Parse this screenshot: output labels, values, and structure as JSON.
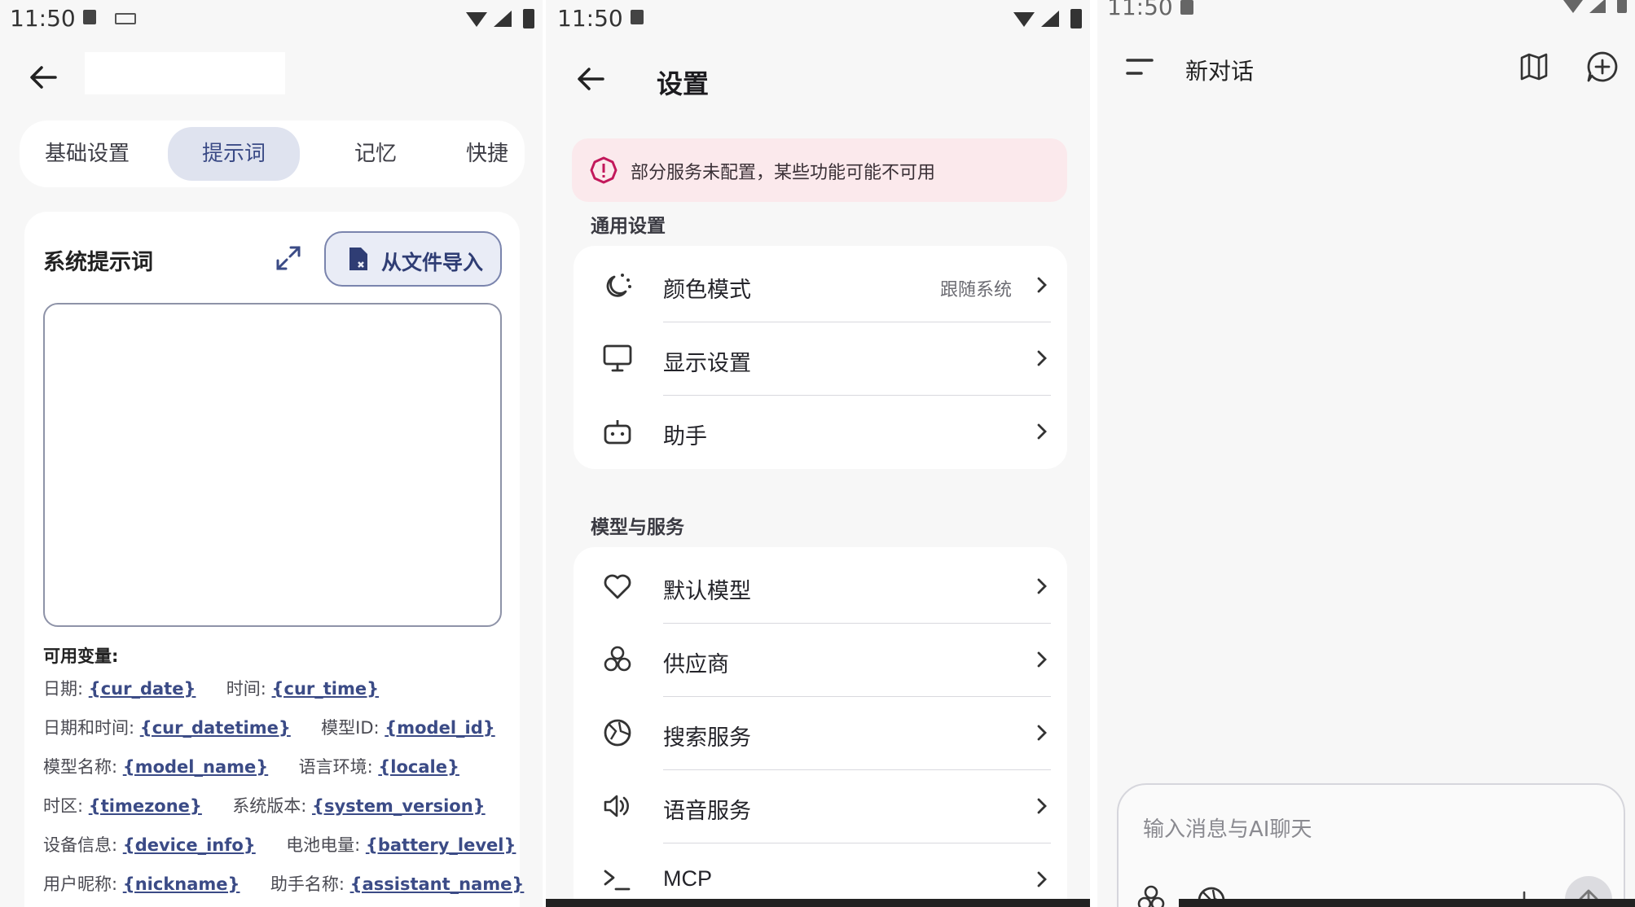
{
  "status": {
    "time_1": "11:50",
    "time_2": "11:50",
    "time_3": "11:50"
  },
  "prompt_screen": {
    "tabs": [
      "基础设置",
      "提示词",
      "记忆",
      "快捷"
    ],
    "selected_tab": "提示词",
    "section_title": "系统提示词",
    "import_button": "从文件导入",
    "prompt_value": "",
    "variables_title": "可用变量:",
    "variables": [
      [
        {
          "label": "日期: ",
          "var": "{cur_date}"
        },
        {
          "label": "时间: ",
          "var": "{cur_time}"
        }
      ],
      [
        {
          "label": "日期和时间: ",
          "var": "{cur_datetime}"
        },
        {
          "label": "模型ID: ",
          "var": "{model_id}"
        }
      ],
      [
        {
          "label": "模型名称: ",
          "var": "{model_name}"
        },
        {
          "label": "语言环境: ",
          "var": "{locale}"
        }
      ],
      [
        {
          "label": "时区: ",
          "var": "{timezone}"
        },
        {
          "label": "系统版本: ",
          "var": "{system_version}"
        }
      ],
      [
        {
          "label": "设备信息: ",
          "var": "{device_info}"
        },
        {
          "label": "电池电量: ",
          "var": "{battery_level}"
        }
      ],
      [
        {
          "label": "用户昵称: ",
          "var": "{nickname}"
        },
        {
          "label": "助手名称: ",
          "var": "{assistant_name}"
        }
      ]
    ]
  },
  "settings_screen": {
    "title": "设置",
    "warning": "部分服务未配置，某些功能可能不可用",
    "general_title": "通用设置",
    "general_items": [
      {
        "icon": "color-mode-icon",
        "label": "颜色模式",
        "value": "跟随系统"
      },
      {
        "icon": "monitor-icon",
        "label": "显示设置",
        "value": ""
      },
      {
        "icon": "robot-icon",
        "label": "助手",
        "value": ""
      }
    ],
    "models_title": "模型与服务",
    "model_items": [
      {
        "icon": "heart-icon",
        "label": "默认模型"
      },
      {
        "icon": "provider-icon",
        "label": "供应商"
      },
      {
        "icon": "search-service-icon",
        "label": "搜索服务"
      },
      {
        "icon": "speaker-icon",
        "label": "语音服务"
      },
      {
        "icon": "terminal-icon",
        "label": "MCP"
      }
    ]
  },
  "chat_screen": {
    "title": "新对话",
    "input_placeholder": "输入消息与AI聊天"
  },
  "colors": {
    "accent": "#3b4b86",
    "warning": "#c2185b",
    "background": "#f7f7f7"
  }
}
